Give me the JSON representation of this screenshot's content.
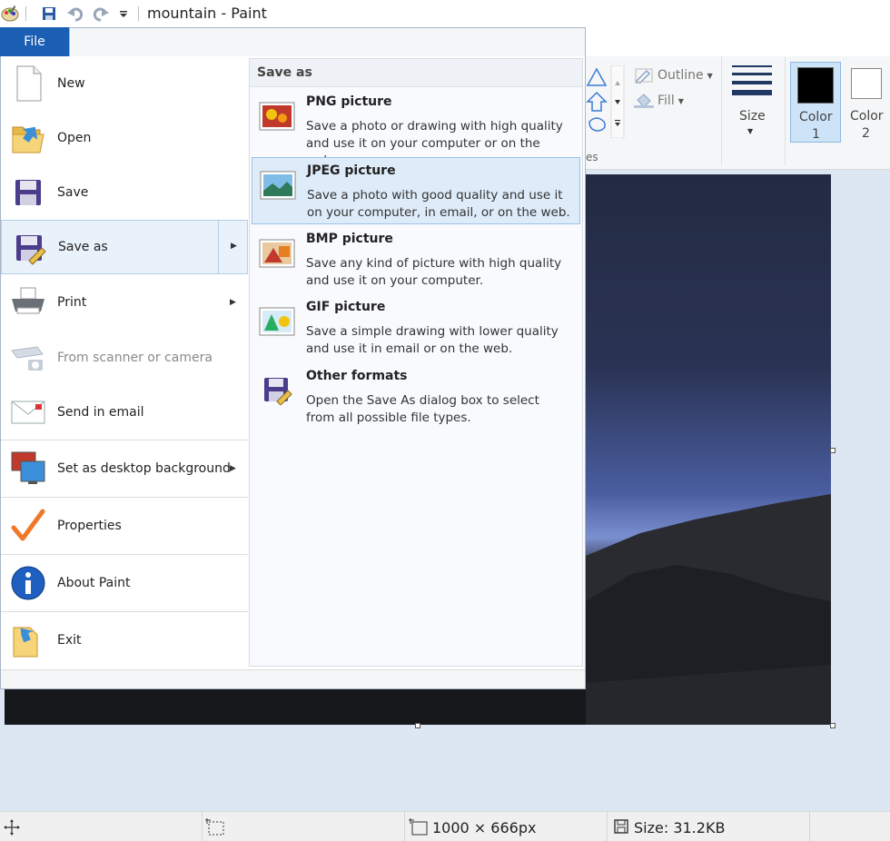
{
  "window": {
    "title": "mountain - Paint"
  },
  "ribbon": {
    "outline_label": "Outline",
    "fill_label": "Fill",
    "shapes_fragment": "es",
    "size_label": "Size",
    "color1_label": "Color",
    "color1_num": "1",
    "color2_label": "Color",
    "color2_num": "2",
    "color1_value": "#000000",
    "color2_value": "#ffffff"
  },
  "file_menu": {
    "button_label": "File",
    "items": [
      {
        "label": "New",
        "icon": "blank-page-icon"
      },
      {
        "label": "Open",
        "icon": "open-folder-icon"
      },
      {
        "label": "Save",
        "icon": "floppy-disk-icon"
      },
      {
        "label": "Save as",
        "icon": "save-as-icon"
      },
      {
        "label": "Print",
        "icon": "printer-icon"
      },
      {
        "label": "From scanner or camera",
        "icon": "scanner-camera-icon"
      },
      {
        "label": "Send in email",
        "icon": "envelope-icon"
      },
      {
        "label": "Set as desktop background",
        "icon": "desktop-background-icon"
      },
      {
        "label": "Properties",
        "icon": "checkmark-icon"
      },
      {
        "label": "About Paint",
        "icon": "info-icon"
      },
      {
        "label": "Exit",
        "icon": "exit-door-icon"
      }
    ],
    "submenu": {
      "header": "Save as",
      "items": [
        {
          "title": "PNG picture",
          "desc": "Save a photo or drawing with high quality and use it on your computer or on the web.",
          "icon": "png-picture-icon"
        },
        {
          "title": "JPEG picture",
          "desc": "Save a photo with good quality and use it on your computer, in email, or on the web.",
          "icon": "jpeg-picture-icon"
        },
        {
          "title": "BMP picture",
          "desc": "Save any kind of picture with high quality and use it on your computer.",
          "icon": "bmp-picture-icon"
        },
        {
          "title": "GIF picture",
          "desc": "Save a simple drawing with lower quality and use it in email or on the web.",
          "icon": "gif-picture-icon"
        },
        {
          "title": "Other formats",
          "desc": "Open the Save As dialog box to select from all possible file types.",
          "icon": "other-formats-icon"
        }
      ]
    }
  },
  "statusbar": {
    "dimensions": "1000 × 666px",
    "size": "Size: 31.2KB"
  }
}
